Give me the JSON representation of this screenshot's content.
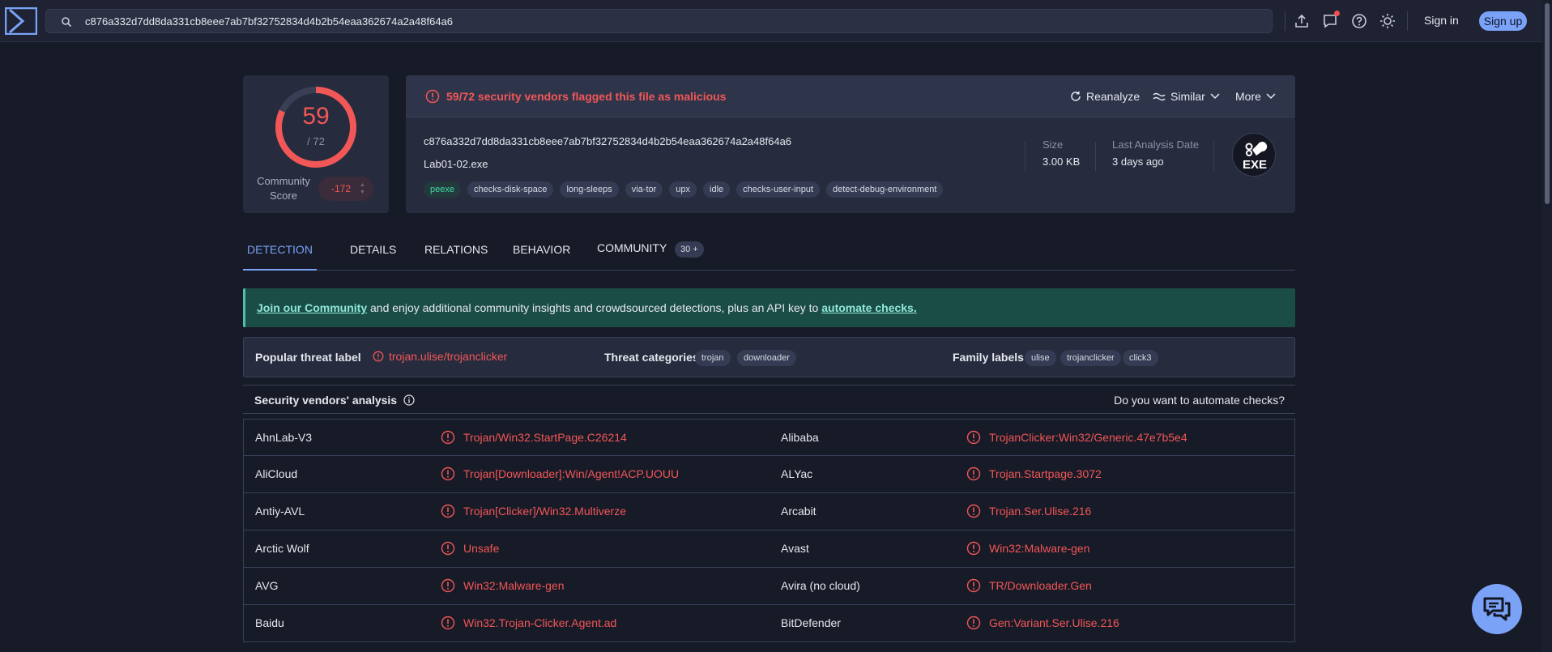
{
  "search": {
    "value": "c876a332d7dd8da331cb8eee7ab7bf32752834d4b2b54eaa362674a2a48f64a6"
  },
  "header": {
    "signin_label": "Sign in",
    "signup_label": "Sign up"
  },
  "score": {
    "detections": "59",
    "total": "/ 72",
    "detected_fraction": 0.8194,
    "community_label": "Community Score",
    "community_value": "-172"
  },
  "summary": {
    "alert": "59/72 security vendors flagged this file as malicious",
    "actions": {
      "reanalyze": "Reanalyze",
      "similar": "Similar",
      "more": "More"
    },
    "hash": "c876a332d7dd8da331cb8eee7ab7bf32752834d4b2b54eaa362674a2a48f64a6",
    "filename": "Lab01-02.exe",
    "tags": [
      "peexe",
      "checks-disk-space",
      "long-sleeps",
      "via-tor",
      "upx",
      "idle",
      "checks-user-input",
      "detect-debug-environment"
    ],
    "size_label": "Size",
    "size_value": "3.00 KB",
    "date_label": "Last Analysis Date",
    "date_value": "3 days ago",
    "filetype": "EXE"
  },
  "tabs": [
    {
      "label": "DETECTION"
    },
    {
      "label": "DETAILS"
    },
    {
      "label": "RELATIONS"
    },
    {
      "label": "BEHAVIOR"
    },
    {
      "label": "COMMUNITY",
      "badge": "30 +"
    }
  ],
  "banner": {
    "link1": "Join our Community",
    "middle": " and enjoy additional community insights and crowdsourced detections, plus an API key to ",
    "link2": "automate checks."
  },
  "labels": {
    "popular_title": "Popular threat label",
    "popular_value": "trojan.ulise/trojanclicker",
    "categories_title": "Threat categories",
    "categories": [
      "trojan",
      "downloader"
    ],
    "family_title": "Family labels",
    "family": [
      "ulise",
      "trojanclicker",
      "click3"
    ]
  },
  "vendors": {
    "title": "Security vendors' analysis",
    "automate": "Do you want to automate checks?",
    "rows": [
      {
        "left_name": "AhnLab-V3",
        "left_result": "Trojan/Win32.StartPage.C26214",
        "right_name": "Alibaba",
        "right_result": "TrojanClicker:Win32/Generic.47e7b5e4"
      },
      {
        "left_name": "AliCloud",
        "left_result": "Trojan[Downloader]:Win/Agent!ACP.UOUU",
        "right_name": "ALYac",
        "right_result": "Trojan.Startpage.3072"
      },
      {
        "left_name": "Antiy-AVL",
        "left_result": "Trojan[Clicker]/Win32.Multiverze",
        "right_name": "Arcabit",
        "right_result": "Trojan.Ser.Ulise.216"
      },
      {
        "left_name": "Arctic Wolf",
        "left_result": "Unsafe",
        "right_name": "Avast",
        "right_result": "Win32:Malware-gen"
      },
      {
        "left_name": "AVG",
        "left_result": "Win32:Malware-gen",
        "right_name": "Avira (no cloud)",
        "right_result": "TR/Downloader.Gen"
      },
      {
        "left_name": "Baidu",
        "left_result": "Win32.Trojan-Clicker.Agent.ad",
        "right_name": "BitDefender",
        "right_result": "Gen:Variant.Ser.Ulise.216"
      }
    ]
  },
  "colors": {
    "malicious": "#f25757",
    "accent": "#7aa2f7",
    "banner": "#1b4d47"
  }
}
